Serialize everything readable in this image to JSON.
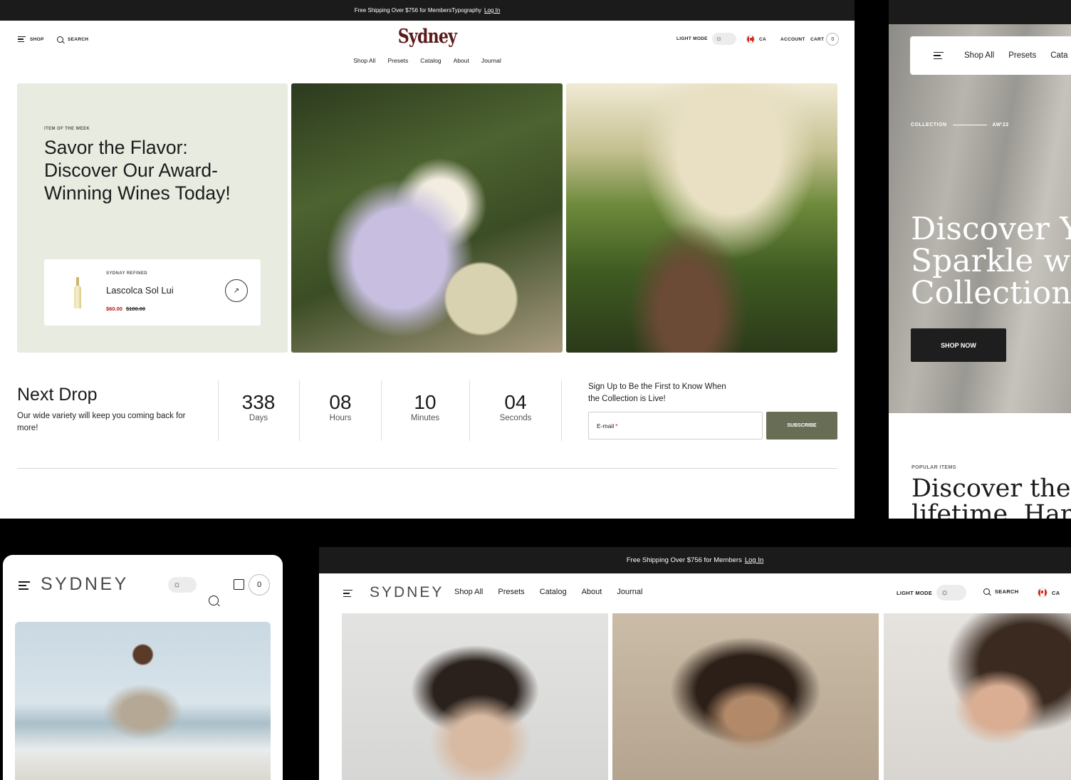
{
  "desktop": {
    "announcement": {
      "text": "Free Shipping Over $756 for MembersTypography",
      "login": "Log In"
    },
    "header": {
      "shop": "SHOP",
      "search": "SEARCH",
      "logo": "Sydney",
      "light_mode": "LIGHT MODE",
      "country": "CA",
      "account": "ACCOUNT",
      "cart": "CART",
      "cart_count": "0"
    },
    "nav": [
      "Shop All",
      "Presets",
      "Catalog",
      "About",
      "Journal"
    ],
    "hero": {
      "eyebrow": "ITEM OF THE WEEK",
      "title": "Savor the Flavor: Discover Our Award-Winning Wines Today!",
      "product": {
        "brand": "SYDNAY REFINED",
        "name": "Lascolca Sol Lui",
        "price": "$60.00",
        "old_price": "$180.00",
        "arrow": "↗"
      }
    },
    "drop": {
      "title": "Next Drop",
      "subtitle": "Our wide variety will keep you coming back for more!",
      "countdown": [
        {
          "value": "338",
          "label": "Days"
        },
        {
          "value": "08",
          "label": "Hours"
        },
        {
          "value": "10",
          "label": "Minutes"
        },
        {
          "value": "04",
          "label": "Seconds"
        }
      ],
      "signup_text": "Sign Up to Be the First to Know When the Collection is Live!",
      "email_placeholder": "E-mail",
      "subscribe": "SUBSCRIBE"
    }
  },
  "right_panel": {
    "nav": [
      "Shop All",
      "Presets",
      "Cata"
    ],
    "collection": "COLLECTION",
    "season": "AW'22",
    "headline": [
      "Discover Yo",
      "Sparkle wit",
      "Collection"
    ],
    "shop_now": "SHOP NOW",
    "popular": "POPULAR ITEMS",
    "popular_headline": [
      "Discover the p",
      "lifetime. Hand"
    ]
  },
  "mobile": {
    "logo": "SYDNEY",
    "cart_count": "0"
  },
  "wide": {
    "announcement": {
      "text": "Free Shipping Over $756 for Members",
      "login": "Log In"
    },
    "logo": "SYDNEY",
    "nav": [
      "Shop All",
      "Presets",
      "Catalog",
      "About",
      "Journal"
    ],
    "light_mode": "LIGHT MODE",
    "search": "SEARCH",
    "country": "CA"
  },
  "colors": {
    "accent_olive": "#686e55",
    "logo_wine": "#5b1a1a",
    "sale_red": "#b3151a",
    "hero_bg": "#e8ebe0"
  }
}
